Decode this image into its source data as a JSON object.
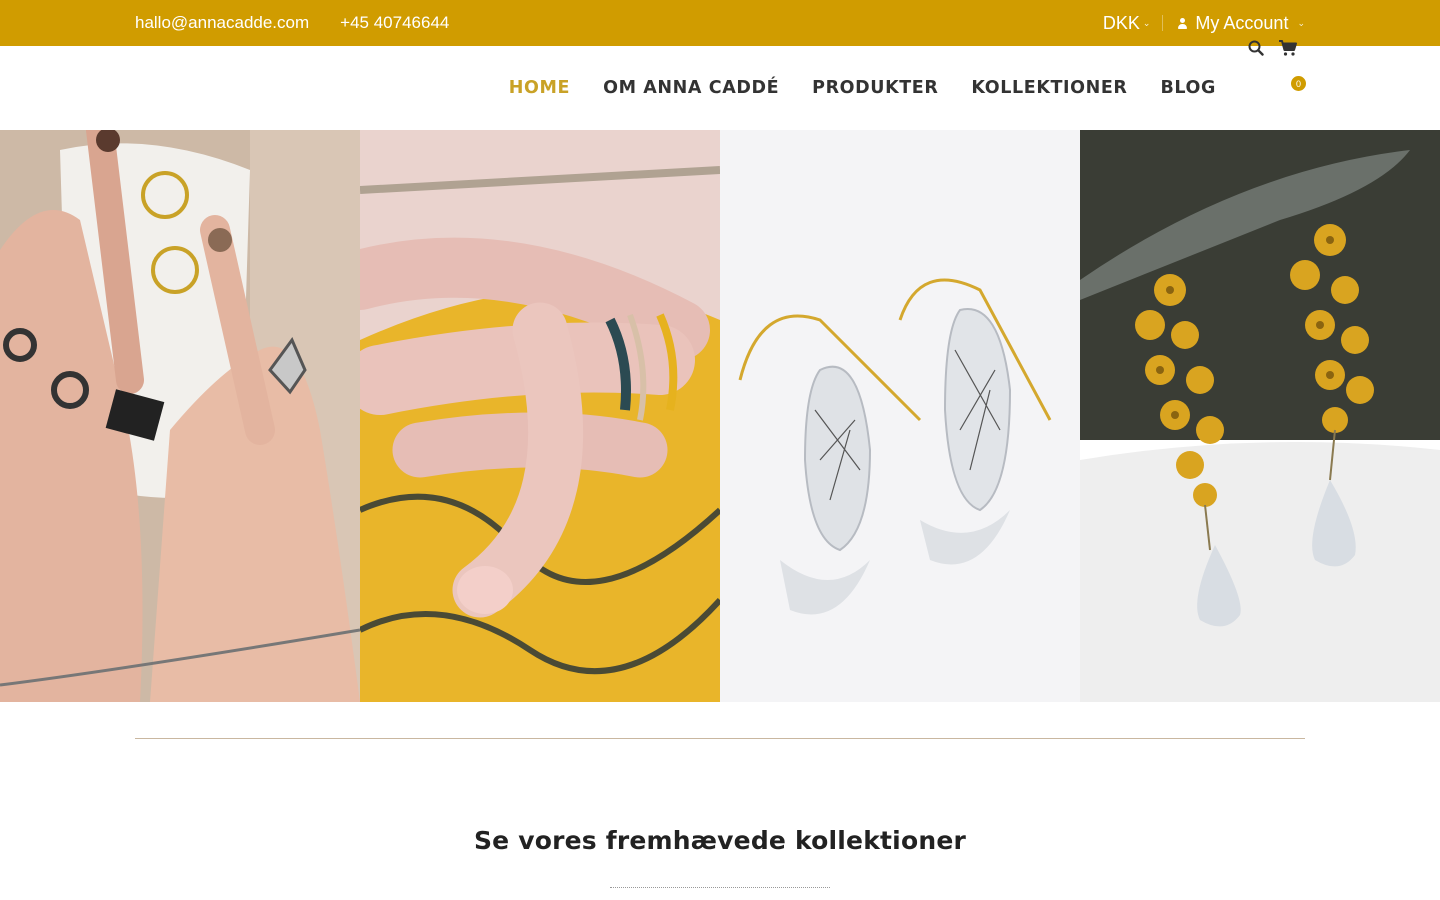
{
  "topbar": {
    "email": "hallo@annacadde.com",
    "phone": "+45 40746644",
    "currency": "DKK",
    "account_label": "My Account"
  },
  "nav": {
    "items": [
      {
        "label": "HOME",
        "active": true
      },
      {
        "label": "OM ANNA CADDÉ",
        "active": false
      },
      {
        "label": "PRODUKTER",
        "active": false
      },
      {
        "label": "KOLLEKTIONER",
        "active": false
      },
      {
        "label": "BLOG",
        "active": false
      }
    ],
    "cart_count": "0"
  },
  "colors": {
    "brand": "#d09c00",
    "active_nav": "#c9a227",
    "nav_text": "#333333"
  },
  "icons": [
    "user-icon",
    "search-icon",
    "cart-icon",
    "chevron-down-icon"
  ],
  "banner": {
    "tiles": [
      {
        "name": "rings-on-hands-with-cup"
      },
      {
        "name": "rings-on-yellow-fabric"
      },
      {
        "name": "quartz-drop-earrings"
      },
      {
        "name": "gold-flower-earrings"
      }
    ]
  },
  "featured": {
    "title": "Se vores fremhævede kollektioner"
  }
}
